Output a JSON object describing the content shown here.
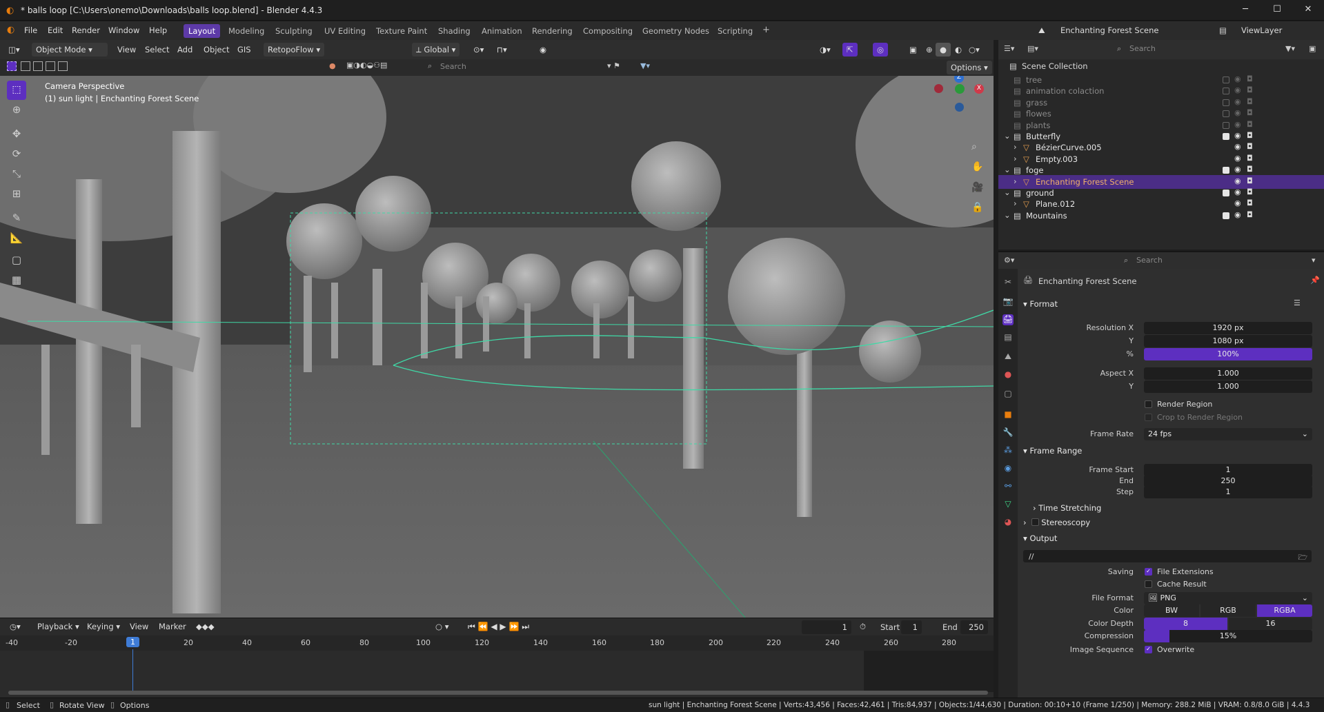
{
  "window": {
    "title": "* balls loop [C:\\Users\\onemo\\Downloads\\balls loop.blend] - Blender 4.4.3",
    "minimize": "─",
    "maximize": "☐",
    "close": "✕"
  },
  "menu": {
    "items": [
      "File",
      "Edit",
      "Render",
      "Window",
      "Help"
    ],
    "workspaces": [
      "Layout",
      "Modeling",
      "Sculpting",
      "UV Editing",
      "Texture Paint",
      "Shading",
      "Animation",
      "Rendering",
      "Compositing",
      "Geometry Nodes",
      "Scripting"
    ],
    "add_workspace": "+",
    "scene_name": "Enchanting Forest Scene",
    "view_layer": "ViewLayer"
  },
  "viewport_header": {
    "mode": "Object Mode",
    "menus": [
      "View",
      "Select",
      "Add",
      "Object",
      "GIS"
    ],
    "addon": "RetopoFlow",
    "transform_orientation": "Global",
    "search_placeholder": "Search",
    "options": "Options"
  },
  "viewport": {
    "overlay_line1": "Camera Perspective",
    "overlay_line2": "(1) sun light | Enchanting Forest Scene",
    "gizmo_z": "Z",
    "gizmo_x": "X",
    "gizmo_y": "Y"
  },
  "timeline_header": {
    "menus": [
      "Playback",
      "Keying",
      "View",
      "Marker"
    ],
    "current_frame": "1",
    "start_label": "Start",
    "start_value": "1",
    "end_label": "End",
    "end_value": "250"
  },
  "timeline": {
    "ticks": [
      "-40",
      "-20",
      "1",
      "20",
      "40",
      "60",
      "80",
      "100",
      "120",
      "140",
      "160",
      "180",
      "200",
      "220",
      "240",
      "260",
      "280"
    ]
  },
  "statusbar": {
    "select": "Select",
    "rotate": "Rotate View",
    "options": "Options",
    "stats": "sun light | Enchanting Forest Scene | Verts:43,456 | Faces:42,461 | Tris:84,937 | Objects:1/44,630 | Duration: 00:10+10 (Frame 1/250) | Memory: 288.2 MiB | VRAM: 0.8/8.0 GiB | 4.4.3"
  },
  "outliner": {
    "search_placeholder": "Search",
    "root": "Scene Collection",
    "rows": [
      {
        "name": "tree",
        "level": 1,
        "checked": false,
        "dim": true
      },
      {
        "name": "animation colaction",
        "level": 1,
        "checked": false,
        "dim": true
      },
      {
        "name": "grass",
        "level": 1,
        "checked": false,
        "dim": true
      },
      {
        "name": "flowes",
        "level": 1,
        "checked": false,
        "dim": true
      },
      {
        "name": "plants",
        "level": 1,
        "checked": false,
        "dim": true
      },
      {
        "name": "Butterfly",
        "level": 1,
        "checked": true,
        "dim": false
      },
      {
        "name": "BézierCurve.005",
        "level": 2,
        "checked": null,
        "dim": false
      },
      {
        "name": "Empty.003",
        "level": 2,
        "checked": null,
        "dim": false
      },
      {
        "name": "foge",
        "level": 1,
        "checked": true,
        "dim": false
      },
      {
        "name": "Enchanting Forest Scene",
        "level": 2,
        "checked": null,
        "dim": false,
        "selected": true
      },
      {
        "name": "ground",
        "level": 1,
        "checked": true,
        "dim": false
      },
      {
        "name": "Plane.012",
        "level": 2,
        "checked": null,
        "dim": false
      },
      {
        "name": "Mountains",
        "level": 1,
        "checked": true,
        "dim": false
      }
    ]
  },
  "properties": {
    "search_placeholder": "Search",
    "scene_name": "Enchanting Forest Scene",
    "format_title": "Format",
    "resolution_x_label": "Resolution X",
    "resolution_x": "1920 px",
    "resolution_y_label": "Y",
    "resolution_y": "1080 px",
    "percent_label": "%",
    "percent": "100%",
    "aspect_x_label": "Aspect X",
    "aspect_x": "1.000",
    "aspect_y_label": "Y",
    "aspect_y": "1.000",
    "render_region": "Render Region",
    "crop_region": "Crop to Render Region",
    "frame_rate_label": "Frame Rate",
    "frame_rate": "24 fps",
    "frame_range_title": "Frame Range",
    "frame_start_label": "Frame Start",
    "frame_start": "1",
    "frame_end_label": "End",
    "frame_end": "250",
    "step_label": "Step",
    "step": "1",
    "time_stretching": "Time Stretching",
    "stereoscopy": "Stereoscopy",
    "output_title": "Output",
    "output_path": "//",
    "saving_label": "Saving",
    "file_extensions": "File Extensions",
    "cache_result": "Cache Result",
    "file_format_label": "File Format",
    "file_format": "PNG",
    "color_label": "Color",
    "color_options": [
      "BW",
      "RGB",
      "RGBA"
    ],
    "color_depth_label": "Color Depth",
    "color_depth_options": [
      "8",
      "16"
    ],
    "compression_label": "Compression",
    "compression": "15%",
    "compression_level": 0.15,
    "image_sequence_label": "Image Sequence",
    "overwrite": "Overwrite"
  },
  "colors": {
    "accent": "#5d2fc0",
    "selection": "#4b2d86",
    "camera_frame": "#3fd9a6"
  }
}
